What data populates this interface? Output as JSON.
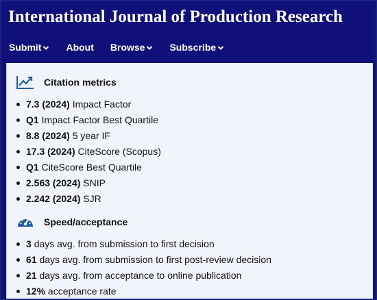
{
  "journal": {
    "title": "International Journal of Production Research"
  },
  "nav": {
    "items": [
      {
        "label": "Submit",
        "has_dropdown": true
      },
      {
        "label": "About",
        "has_dropdown": false
      },
      {
        "label": "Browse",
        "has_dropdown": true
      },
      {
        "label": "Subscribe",
        "has_dropdown": true
      }
    ]
  },
  "citation": {
    "heading": "Citation metrics",
    "icon": "line-chart-icon",
    "items": [
      {
        "value": "7.3 (2024)",
        "label": "Impact Factor"
      },
      {
        "value": "Q1",
        "label": "Impact Factor Best Quartile"
      },
      {
        "value": "8.8 (2024)",
        "label": "5 year IF"
      },
      {
        "value": "17.3 (2024)",
        "label": "CiteScore (Scopus)"
      },
      {
        "value": "Q1",
        "label": "CiteScore Best Quartile"
      },
      {
        "value": "2.563 (2024)",
        "label": "SNIP"
      },
      {
        "value": "2.242 (2024)",
        "label": "SJR"
      }
    ]
  },
  "speed": {
    "heading": "Speed/acceptance",
    "icon": "speedometer-icon",
    "items": [
      {
        "value": "3",
        "label": "days avg. from submission to first decision"
      },
      {
        "value": "61",
        "label": "days avg. from submission to first post-review decision"
      },
      {
        "value": "21",
        "label": "days avg. from acceptance to online publication"
      },
      {
        "value": "12%",
        "label": "acceptance rate"
      }
    ]
  },
  "colors": {
    "header_bg": "#10107a",
    "content_bg": "#f2f4fb",
    "icon_blue": "#1f5fa8"
  }
}
